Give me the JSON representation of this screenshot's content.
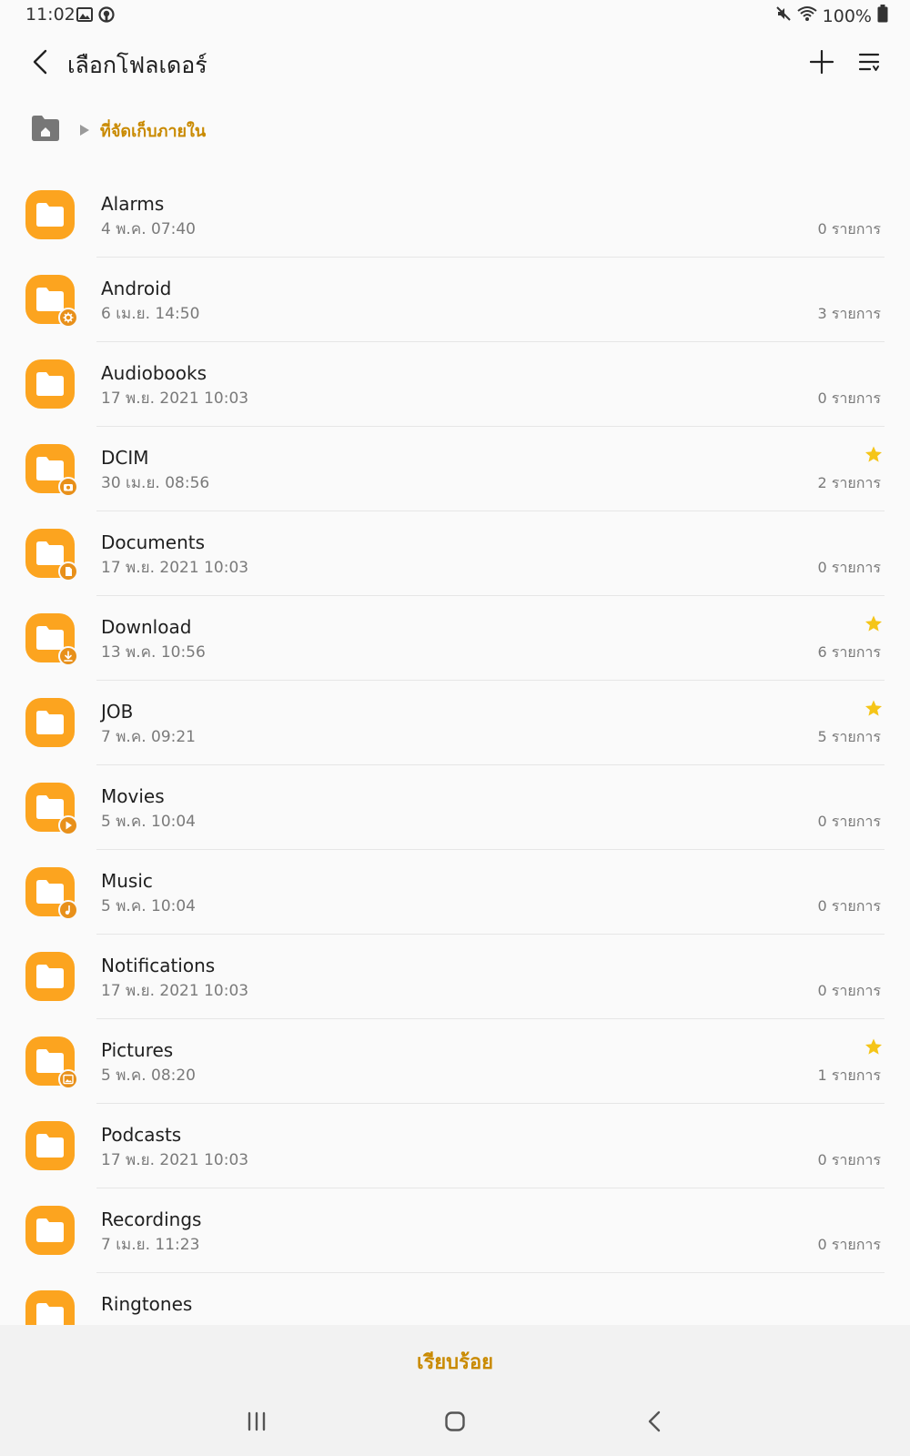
{
  "status_bar": {
    "time": "11:02",
    "battery": "100%",
    "icons": [
      "image-icon",
      "github-icon",
      "mute-icon",
      "wifi-icon",
      "battery-icon"
    ]
  },
  "header": {
    "title": "เลือกโฟลเดอร์",
    "icons": [
      "back-arrow-icon",
      "plus-icon",
      "sort-menu-icon"
    ]
  },
  "breadcrumb": {
    "location": "ที่จัดเก็บภายใน",
    "icons": [
      "home-folder-icon",
      "triangle-right-icon"
    ]
  },
  "folders": [
    {
      "name": "Alarms",
      "date": "4 พ.ค. 07:40",
      "count": "0 รายการ",
      "starred": false,
      "badge": ""
    },
    {
      "name": "Android",
      "date": "6 เม.ย. 14:50",
      "count": "3 รายการ",
      "starred": false,
      "badge": "gear"
    },
    {
      "name": "Audiobooks",
      "date": "17 พ.ย. 2021 10:03",
      "count": "0 รายการ",
      "starred": false,
      "badge": ""
    },
    {
      "name": "DCIM",
      "date": "30 เม.ย. 08:56",
      "count": "2 รายการ",
      "starred": true,
      "badge": "camera"
    },
    {
      "name": "Documents",
      "date": "17 พ.ย. 2021 10:03",
      "count": "0 รายการ",
      "starred": false,
      "badge": "document"
    },
    {
      "name": "Download",
      "date": "13 พ.ค. 10:56",
      "count": "6 รายการ",
      "starred": true,
      "badge": "download"
    },
    {
      "name": "JOB",
      "date": "7 พ.ค. 09:21",
      "count": "5 รายการ",
      "starred": true,
      "badge": ""
    },
    {
      "name": "Movies",
      "date": "5 พ.ค. 10:04",
      "count": "0 รายการ",
      "starred": false,
      "badge": "play"
    },
    {
      "name": "Music",
      "date": "5 พ.ค. 10:04",
      "count": "0 รายการ",
      "starred": false,
      "badge": "music"
    },
    {
      "name": "Notifications",
      "date": "17 พ.ย. 2021 10:03",
      "count": "0 รายการ",
      "starred": false,
      "badge": ""
    },
    {
      "name": "Pictures",
      "date": "5 พ.ค. 08:20",
      "count": "1 รายการ",
      "starred": true,
      "badge": "image"
    },
    {
      "name": "Podcasts",
      "date": "17 พ.ย. 2021 10:03",
      "count": "0 รายการ",
      "starred": false,
      "badge": ""
    },
    {
      "name": "Recordings",
      "date": "7 เม.ย. 11:23",
      "count": "0 รายการ",
      "starred": false,
      "badge": ""
    },
    {
      "name": "Ringtones",
      "date": "",
      "count": "",
      "starred": false,
      "badge": ""
    }
  ],
  "footer": {
    "done_label": "เรียบร้อย",
    "nav_icons": [
      "recents-icon",
      "home-icon",
      "back-icon"
    ]
  },
  "colors": {
    "folder": "#fca41f",
    "badge": "#e8901a",
    "accent_text": "#c98a00",
    "star": "#f5c518"
  }
}
